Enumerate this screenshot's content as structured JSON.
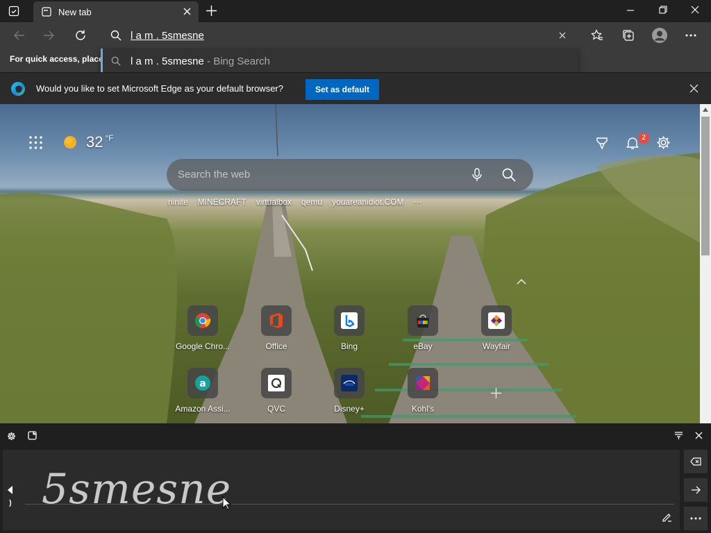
{
  "tab": {
    "title": "New tab"
  },
  "omnibox": {
    "value": "l a m . 5smesne"
  },
  "suggestion": {
    "query": "l a m . 5smesne",
    "source": " - Bing Search"
  },
  "favorites_bar": {
    "hint": "For quick access, place y"
  },
  "default_browser_bar": {
    "message": "Would you like to set Microsoft Edge as your default browser?",
    "button": "Set as default"
  },
  "weather": {
    "temperature": "32",
    "unit": "°F"
  },
  "notifications": {
    "count": "2"
  },
  "search": {
    "placeholder": "Search the web"
  },
  "quick_links": [
    "ninite",
    "MINECRAFT",
    "virtualbox",
    "qemu",
    "youareanidiot.COM"
  ],
  "tiles": [
    {
      "label": "Google Chro...",
      "icon": "chrome-icon"
    },
    {
      "label": "Office",
      "icon": "office-icon"
    },
    {
      "label": "Bing",
      "icon": "bing-icon"
    },
    {
      "label": "eBay",
      "icon": "ebay-icon"
    },
    {
      "label": "Wayfair",
      "icon": "wayfair-icon"
    },
    {
      "label": "Amazon Assi...",
      "icon": "amazon-assistant-icon"
    },
    {
      "label": "QVC",
      "icon": "qvc-icon"
    },
    {
      "label": "Disney+",
      "icon": "disney-plus-icon"
    },
    {
      "label": "Kohl's",
      "icon": "kohls-icon"
    }
  ],
  "handwriting": {
    "ink": "5smesne"
  },
  "colors": {
    "accent": "#0067c0",
    "badge": "#e74c3c",
    "toolbar": "#3b3b3b"
  }
}
